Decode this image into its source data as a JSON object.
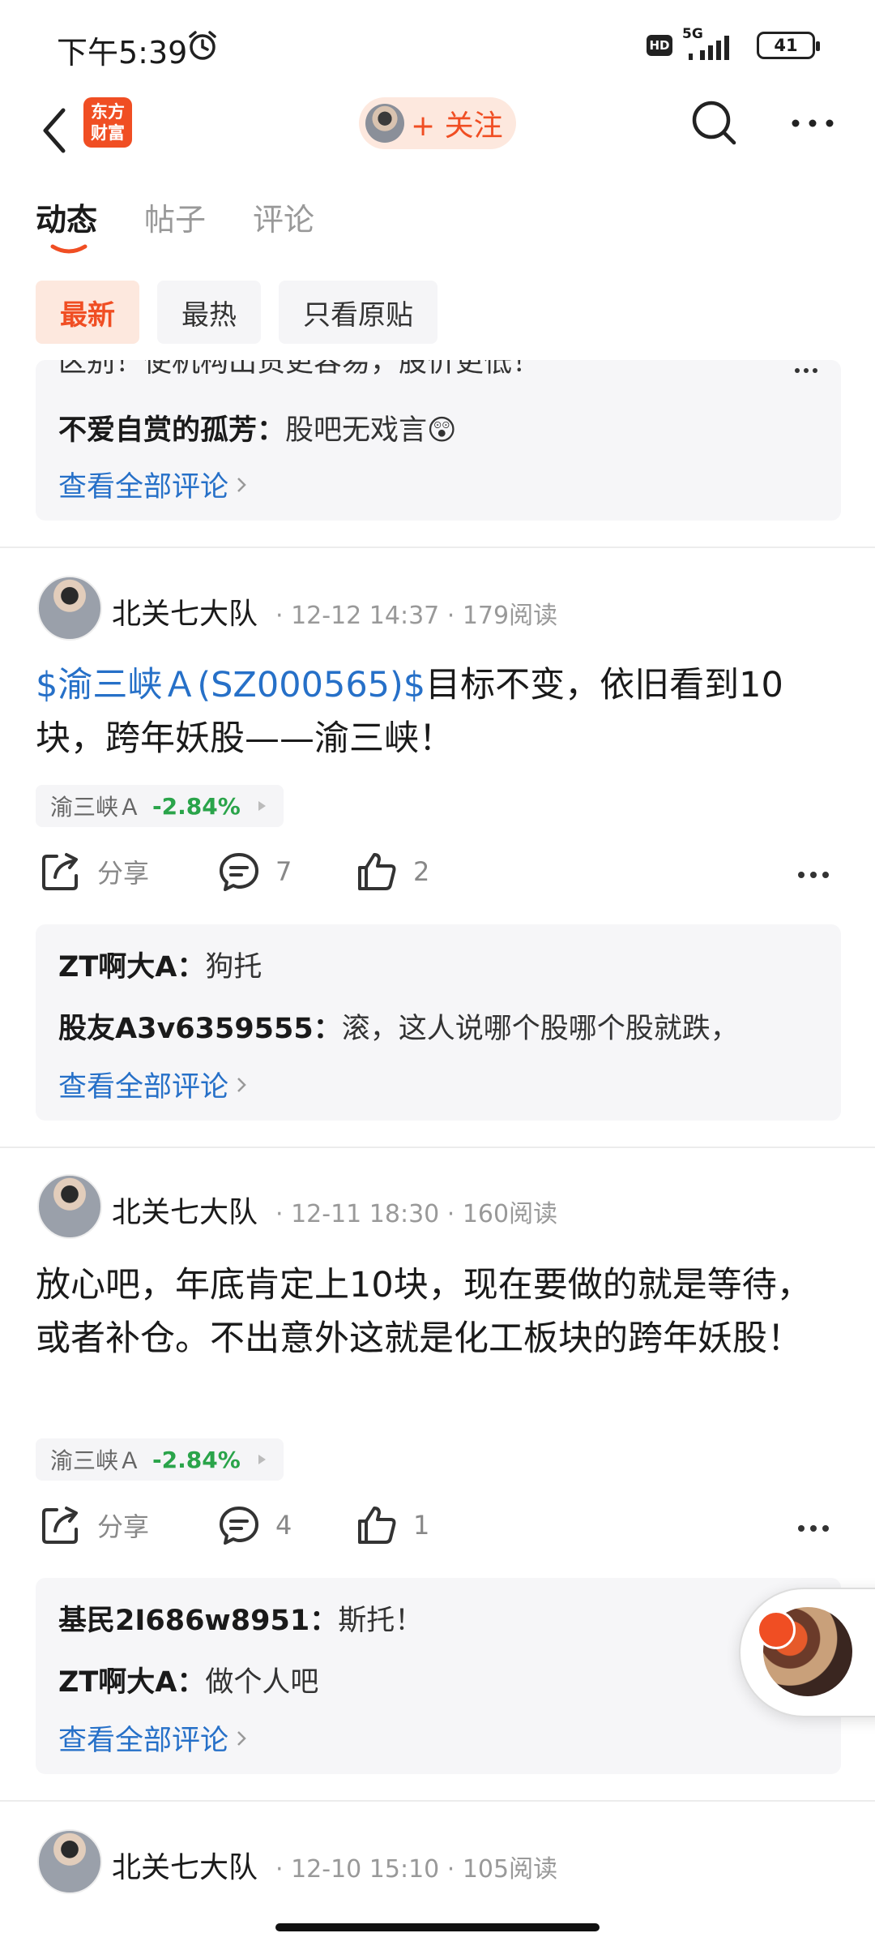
{
  "status_bar": {
    "time": "下午5:39",
    "hd": "HD",
    "network": "5G",
    "battery": "41"
  },
  "nav": {
    "logo_text_1": "东方",
    "logo_text_2": "财富",
    "follow_label": "+ 关注"
  },
  "tabs": [
    {
      "label": "动态"
    },
    {
      "label": "帖子"
    },
    {
      "label": "评论"
    }
  ],
  "filters": [
    {
      "label": "最新"
    },
    {
      "label": "最热"
    },
    {
      "label": "只看原贴"
    }
  ],
  "top_comments": {
    "clipped_text": "区别！使机构出货更容易，股价更低！",
    "lines": [
      {
        "author": "不爱自赏的孤芳：",
        "text": "股吧无戏言😲"
      }
    ],
    "view_all": "查看全部评论"
  },
  "posts": [
    {
      "author": "北关七大队",
      "meta": "· 12-12 14:37 · 179阅读",
      "stock_link": "$渝三峡Ａ(SZ000565)$",
      "body": "目标不变，依旧看到10块，跨年妖股——渝三峡！",
      "stock_name": "渝三峡Ａ",
      "stock_change": "-2.84%",
      "share_label": "分享",
      "comment_count": "7",
      "like_count": "2",
      "comments": [
        {
          "author": "ZT啊大A：",
          "text": "狗托"
        },
        {
          "author": "股友A3v6359555：",
          "text": "滚，这人说哪个股哪个股就跌，"
        }
      ],
      "view_all": "查看全部评论"
    },
    {
      "author": "北关七大队",
      "meta": "· 12-11 18:30 · 160阅读",
      "body": "放心吧，年底肯定上10块，现在要做的就是等待，或者补仓。不出意外这就是化工板块的跨年妖股！",
      "stock_name": "渝三峡Ａ",
      "stock_change": "-2.84%",
      "share_label": "分享",
      "comment_count": "4",
      "like_count": "1",
      "comments": [
        {
          "author": "基民2I686w8951：",
          "text": "斯托！"
        },
        {
          "author": "ZT啊大A：",
          "text": "做个人吧"
        }
      ],
      "view_all": "查看全部评论"
    },
    {
      "author": "北关七大队",
      "meta": "· 12-10 15:10 · 105阅读"
    }
  ],
  "colors": {
    "accent": "#f04e23",
    "link": "#2670c8",
    "down_green": "#2aa44a"
  }
}
